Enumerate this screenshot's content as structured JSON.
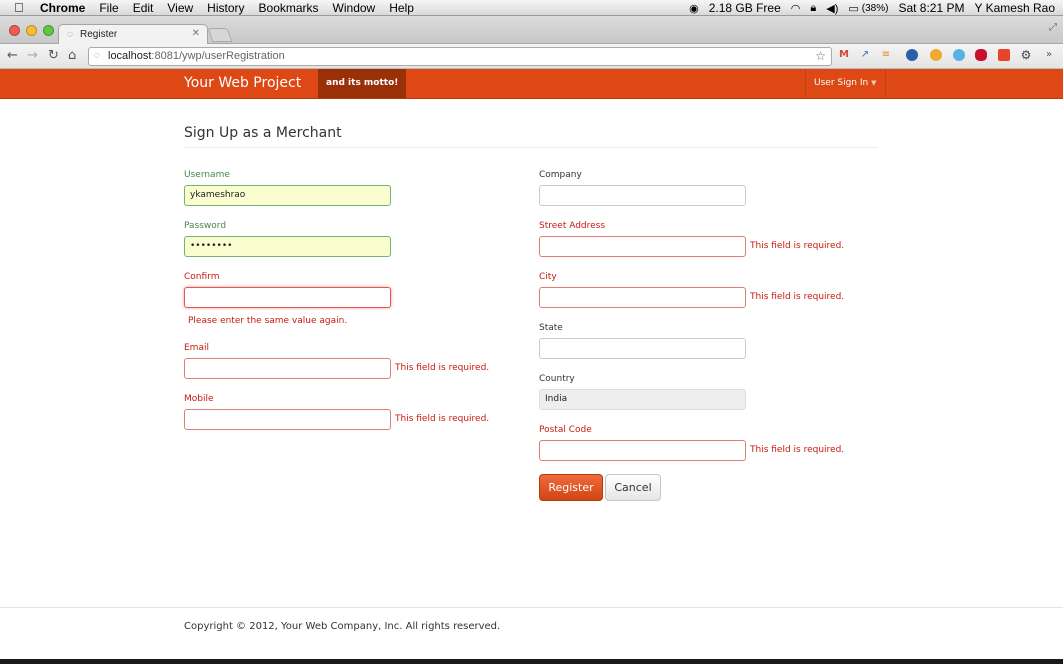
{
  "menubar": {
    "apple": "",
    "app": "Chrome",
    "items": [
      "File",
      "Edit",
      "View",
      "History",
      "Bookmarks",
      "Window",
      "Help"
    ],
    "memory": "2.18 GB Free",
    "battery": "(38%)",
    "clock": "Sat 8:21 PM",
    "user": "Y Kamesh Rao"
  },
  "browser": {
    "tab_title": "Register",
    "url_host": "localhost",
    "url_path": ":8081/ywp/userRegistration"
  },
  "site": {
    "brand": "Your Web Project",
    "motto": "and its motto!",
    "signin": "User Sign In",
    "accent_color": "#dd4814"
  },
  "form": {
    "heading": "Sign Up as a Merchant",
    "username": {
      "label": "Username",
      "value": "ykameshrao"
    },
    "password": {
      "label": "Password",
      "value": "••••••••"
    },
    "confirm": {
      "label": "Confirm",
      "value": "",
      "error": "Please enter the same value again."
    },
    "email": {
      "label": "Email",
      "value": "",
      "error": "This field is required."
    },
    "mobile": {
      "label": "Mobile",
      "value": "",
      "error": "This field is required."
    },
    "company": {
      "label": "Company",
      "value": ""
    },
    "street": {
      "label": "Street Address",
      "value": "",
      "error": "This field is required."
    },
    "city": {
      "label": "City",
      "value": "",
      "error": "This field is required."
    },
    "state": {
      "label": "State",
      "value": ""
    },
    "country": {
      "label": "Country",
      "value": "India"
    },
    "postal": {
      "label": "Postal Code",
      "value": "",
      "error": "This field is required."
    },
    "register_label": "Register",
    "cancel_label": "Cancel"
  },
  "footer": {
    "copyright": "Copyright © 2012, Your Web Company, Inc. All rights reserved."
  }
}
